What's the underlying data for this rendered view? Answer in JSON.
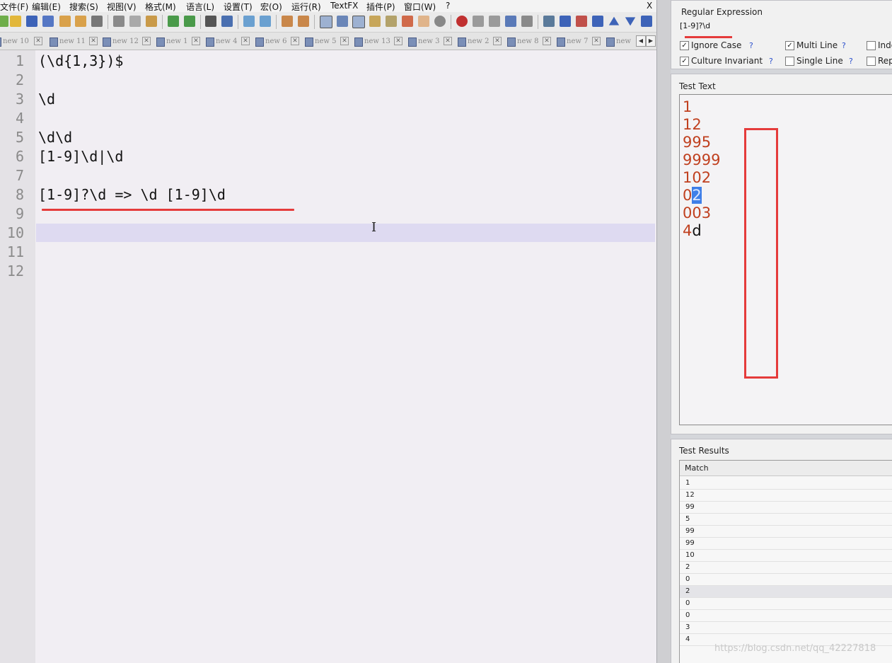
{
  "editor": {
    "menu": [
      "文件(F)",
      "编辑(E)",
      "搜索(S)",
      "视图(V)",
      "格式(M)",
      "语言(L)",
      "设置(T)",
      "宏(O)",
      "运行(R)",
      "TextFX",
      "插件(P)",
      "窗口(W)",
      "?"
    ],
    "close_label": "X",
    "tabs": [
      "new 10",
      "new 11",
      "new 12",
      "new 1",
      "new 4",
      "new 6",
      "new 5",
      "new 13",
      "new 3",
      "new 2",
      "new 8",
      "new 7",
      "new"
    ],
    "line_numbers": [
      "1",
      "2",
      "3",
      "4",
      "5",
      "6",
      "7",
      "8",
      "9",
      "10",
      "11",
      "12"
    ],
    "lines": [
      "(\\d{1,3})$",
      "",
      "\\d",
      "",
      "\\d\\d",
      "[1-9]\\d|\\d",
      "",
      "[1-9]?\\d => \\d [1-9]\\d",
      "",
      "",
      "",
      ""
    ],
    "annotation_color": "#e53b3b",
    "current_line_color": "#dedaf1"
  },
  "regex_panel": {
    "title": "Regular Expression",
    "expression": "[1-9]?\\d",
    "options": [
      {
        "label": "Ignore Case",
        "checked": true,
        "mark": "✓",
        "help": "?"
      },
      {
        "label": "Multi Line",
        "checked": true,
        "mark": "✓",
        "help": "?"
      },
      {
        "label": "Inde",
        "checked": false,
        "mark": "",
        "help": ""
      },
      {
        "label": "Culture Invariant",
        "checked": true,
        "mark": "✓",
        "help": "?"
      },
      {
        "label": "Single Line",
        "checked": false,
        "mark": "",
        "help": "?"
      },
      {
        "label": "Rep",
        "checked": false,
        "mark": "",
        "help": ""
      }
    ],
    "test_text_title": "Test Text",
    "test_text": [
      {
        "pre": "1",
        "hl": "",
        "post": ""
      },
      {
        "pre": "12",
        "hl": "",
        "post": ""
      },
      {
        "pre": "995",
        "hl": "",
        "post": ""
      },
      {
        "pre": "9999",
        "hl": "",
        "post": ""
      },
      {
        "pre": "102",
        "hl": "",
        "post": ""
      },
      {
        "pre": "0",
        "hl": "2",
        "post": ""
      },
      {
        "pre": "003",
        "hl": "",
        "post": ""
      },
      {
        "pre": "4",
        "hl": "",
        "post": "d"
      }
    ],
    "match_color": "#c0401f",
    "results_title": "Test Results",
    "results_header": "Match",
    "results": [
      "1",
      "12",
      "99",
      "5",
      "99",
      "99",
      "10",
      "2",
      "0",
      "2",
      "0",
      "0",
      "3",
      "4"
    ],
    "selected_result_index": 9
  },
  "watermark": "https://blog.csdn.net/qq_42227818"
}
